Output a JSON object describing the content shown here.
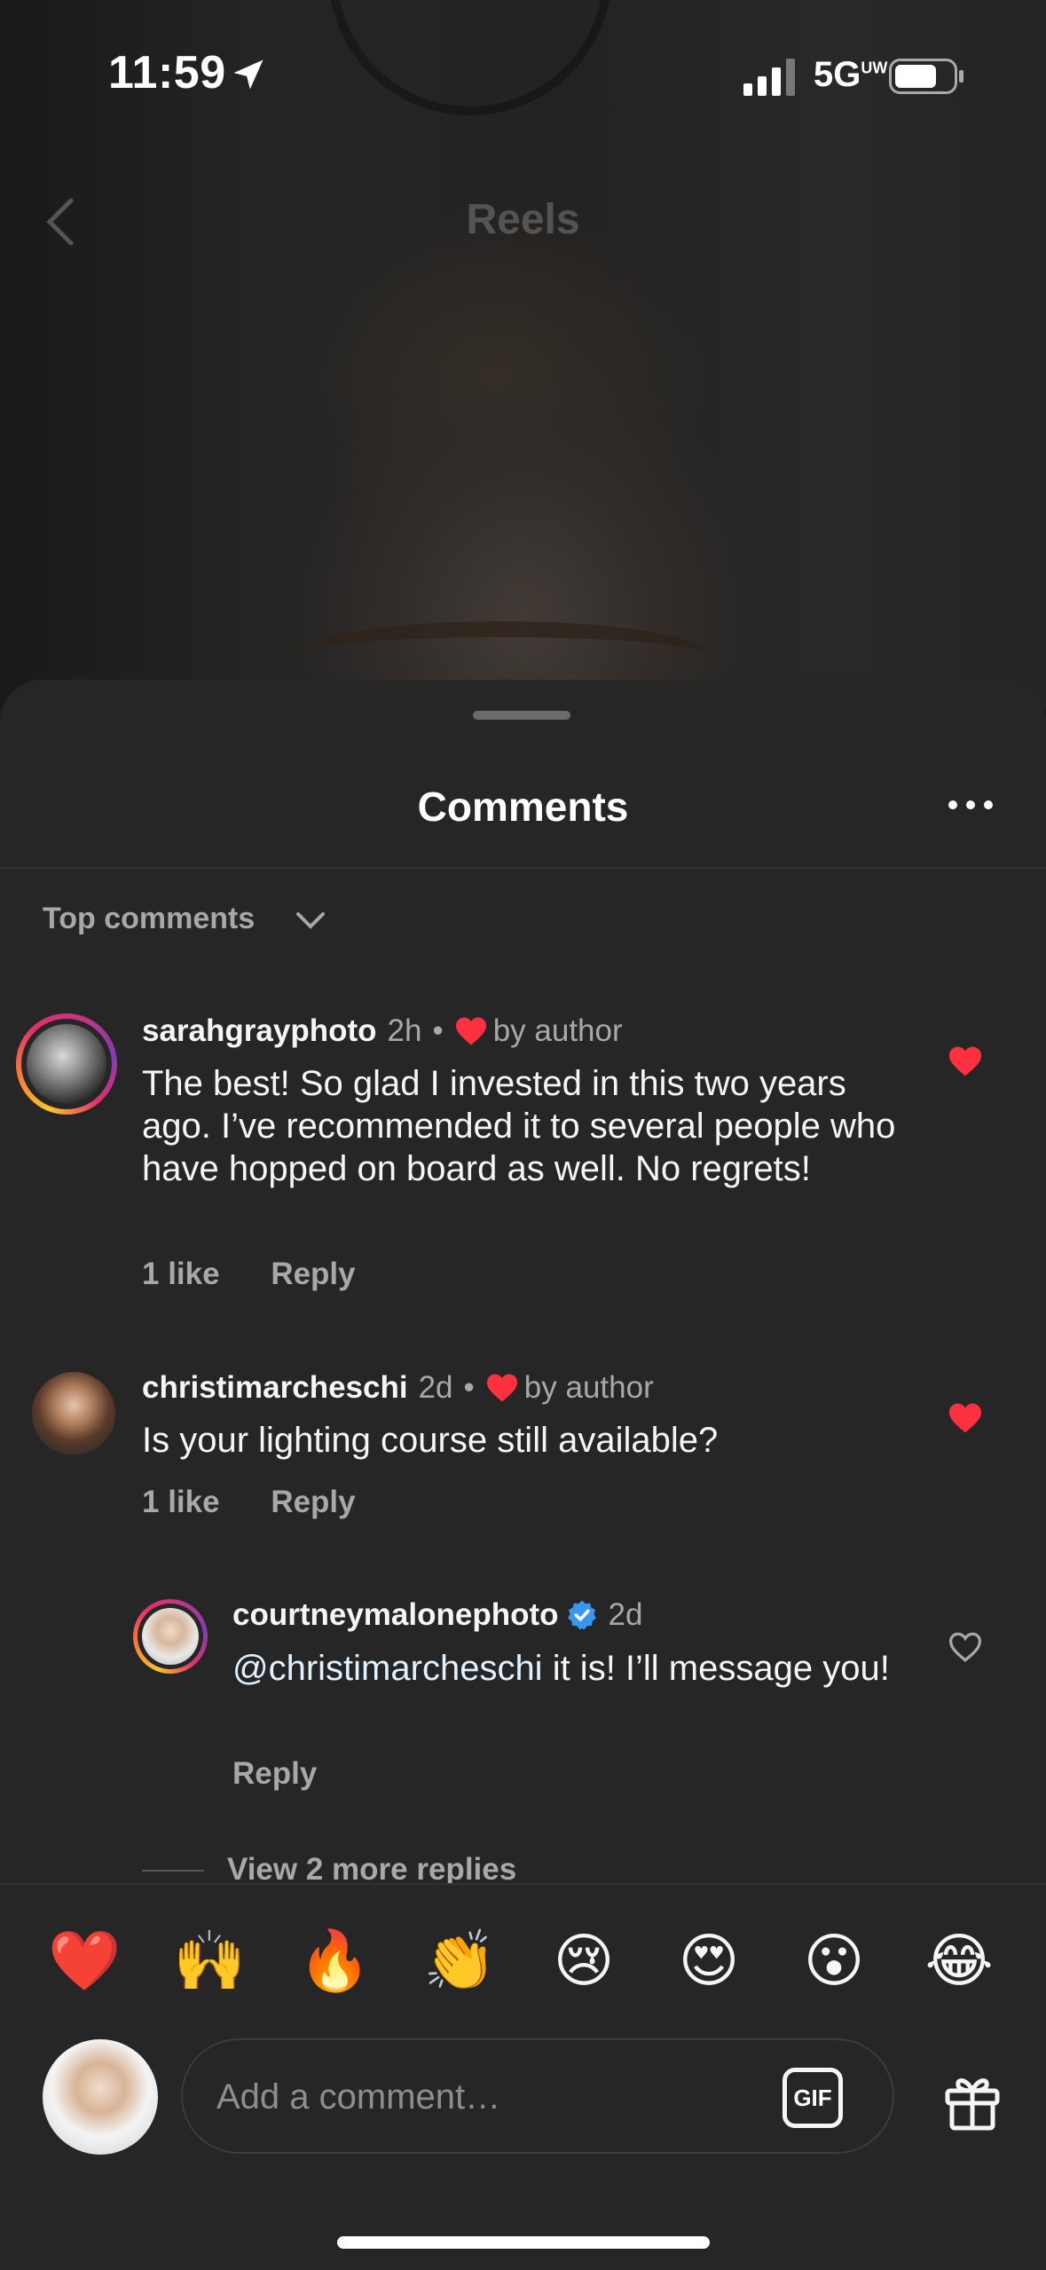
{
  "status_bar": {
    "time": "11:59",
    "network": "5G",
    "network_sup": "UW"
  },
  "nav": {
    "title": "Reels"
  },
  "sheet": {
    "title": "Comments",
    "sort_label": "Top comments"
  },
  "comments": [
    {
      "username": "sarahgrayphoto",
      "time": "2h",
      "dot": "•",
      "liked_by_author": "by author",
      "text": "The best! So glad I invested in this two years ago. I’ve recommended it to several people who have hopped on board as well. No regrets!",
      "likes": "1 like",
      "reply_label": "Reply",
      "liked": true
    },
    {
      "username": "christimarcheschi",
      "time": "2d",
      "dot": "•",
      "liked_by_author": "by author",
      "text": "Is your lighting course still available?",
      "likes": "1 like",
      "reply_label": "Reply",
      "liked": true,
      "reply": {
        "username": "courtneymalonephoto",
        "verified": true,
        "time": "2d",
        "mention": "@christimarcheschi",
        "text": " it is! I’ll message you!",
        "reply_label": "Reply",
        "liked": false
      },
      "view_more_replies": "View 2 more replies"
    }
  ],
  "quick_reactions": [
    "❤️",
    "🙌",
    "🔥",
    "👏",
    "😢",
    "😍",
    "😮",
    "😂"
  ],
  "composer": {
    "placeholder": "Add a comment…",
    "gif_label": "GIF"
  },
  "colors": {
    "heart": "#ff3040",
    "verified": "#3897f0",
    "sheet_bg": "#262626"
  }
}
